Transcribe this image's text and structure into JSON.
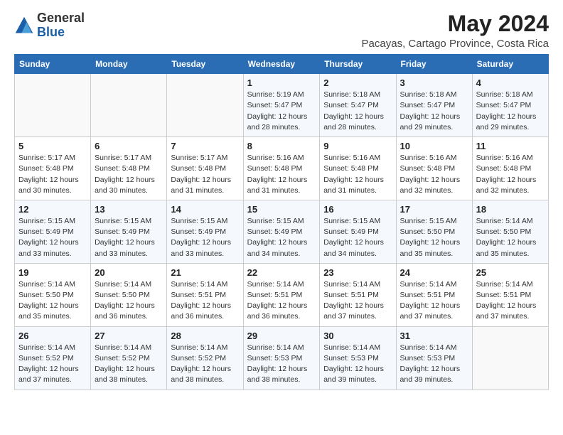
{
  "header": {
    "logo_line1": "General",
    "logo_line2": "Blue",
    "title": "May 2024",
    "subtitle": "Pacayas, Cartago Province, Costa Rica"
  },
  "weekdays": [
    "Sunday",
    "Monday",
    "Tuesday",
    "Wednesday",
    "Thursday",
    "Friday",
    "Saturday"
  ],
  "weeks": [
    [
      {
        "day": "",
        "info": ""
      },
      {
        "day": "",
        "info": ""
      },
      {
        "day": "",
        "info": ""
      },
      {
        "day": "1",
        "info": "Sunrise: 5:19 AM\nSunset: 5:47 PM\nDaylight: 12 hours\nand 28 minutes."
      },
      {
        "day": "2",
        "info": "Sunrise: 5:18 AM\nSunset: 5:47 PM\nDaylight: 12 hours\nand 28 minutes."
      },
      {
        "day": "3",
        "info": "Sunrise: 5:18 AM\nSunset: 5:47 PM\nDaylight: 12 hours\nand 29 minutes."
      },
      {
        "day": "4",
        "info": "Sunrise: 5:18 AM\nSunset: 5:47 PM\nDaylight: 12 hours\nand 29 minutes."
      }
    ],
    [
      {
        "day": "5",
        "info": "Sunrise: 5:17 AM\nSunset: 5:48 PM\nDaylight: 12 hours\nand 30 minutes."
      },
      {
        "day": "6",
        "info": "Sunrise: 5:17 AM\nSunset: 5:48 PM\nDaylight: 12 hours\nand 30 minutes."
      },
      {
        "day": "7",
        "info": "Sunrise: 5:17 AM\nSunset: 5:48 PM\nDaylight: 12 hours\nand 31 minutes."
      },
      {
        "day": "8",
        "info": "Sunrise: 5:16 AM\nSunset: 5:48 PM\nDaylight: 12 hours\nand 31 minutes."
      },
      {
        "day": "9",
        "info": "Sunrise: 5:16 AM\nSunset: 5:48 PM\nDaylight: 12 hours\nand 31 minutes."
      },
      {
        "day": "10",
        "info": "Sunrise: 5:16 AM\nSunset: 5:48 PM\nDaylight: 12 hours\nand 32 minutes."
      },
      {
        "day": "11",
        "info": "Sunrise: 5:16 AM\nSunset: 5:48 PM\nDaylight: 12 hours\nand 32 minutes."
      }
    ],
    [
      {
        "day": "12",
        "info": "Sunrise: 5:15 AM\nSunset: 5:49 PM\nDaylight: 12 hours\nand 33 minutes."
      },
      {
        "day": "13",
        "info": "Sunrise: 5:15 AM\nSunset: 5:49 PM\nDaylight: 12 hours\nand 33 minutes."
      },
      {
        "day": "14",
        "info": "Sunrise: 5:15 AM\nSunset: 5:49 PM\nDaylight: 12 hours\nand 33 minutes."
      },
      {
        "day": "15",
        "info": "Sunrise: 5:15 AM\nSunset: 5:49 PM\nDaylight: 12 hours\nand 34 minutes."
      },
      {
        "day": "16",
        "info": "Sunrise: 5:15 AM\nSunset: 5:49 PM\nDaylight: 12 hours\nand 34 minutes."
      },
      {
        "day": "17",
        "info": "Sunrise: 5:15 AM\nSunset: 5:50 PM\nDaylight: 12 hours\nand 35 minutes."
      },
      {
        "day": "18",
        "info": "Sunrise: 5:14 AM\nSunset: 5:50 PM\nDaylight: 12 hours\nand 35 minutes."
      }
    ],
    [
      {
        "day": "19",
        "info": "Sunrise: 5:14 AM\nSunset: 5:50 PM\nDaylight: 12 hours\nand 35 minutes."
      },
      {
        "day": "20",
        "info": "Sunrise: 5:14 AM\nSunset: 5:50 PM\nDaylight: 12 hours\nand 36 minutes."
      },
      {
        "day": "21",
        "info": "Sunrise: 5:14 AM\nSunset: 5:51 PM\nDaylight: 12 hours\nand 36 minutes."
      },
      {
        "day": "22",
        "info": "Sunrise: 5:14 AM\nSunset: 5:51 PM\nDaylight: 12 hours\nand 36 minutes."
      },
      {
        "day": "23",
        "info": "Sunrise: 5:14 AM\nSunset: 5:51 PM\nDaylight: 12 hours\nand 37 minutes."
      },
      {
        "day": "24",
        "info": "Sunrise: 5:14 AM\nSunset: 5:51 PM\nDaylight: 12 hours\nand 37 minutes."
      },
      {
        "day": "25",
        "info": "Sunrise: 5:14 AM\nSunset: 5:51 PM\nDaylight: 12 hours\nand 37 minutes."
      }
    ],
    [
      {
        "day": "26",
        "info": "Sunrise: 5:14 AM\nSunset: 5:52 PM\nDaylight: 12 hours\nand 37 minutes."
      },
      {
        "day": "27",
        "info": "Sunrise: 5:14 AM\nSunset: 5:52 PM\nDaylight: 12 hours\nand 38 minutes."
      },
      {
        "day": "28",
        "info": "Sunrise: 5:14 AM\nSunset: 5:52 PM\nDaylight: 12 hours\nand 38 minutes."
      },
      {
        "day": "29",
        "info": "Sunrise: 5:14 AM\nSunset: 5:53 PM\nDaylight: 12 hours\nand 38 minutes."
      },
      {
        "day": "30",
        "info": "Sunrise: 5:14 AM\nSunset: 5:53 PM\nDaylight: 12 hours\nand 39 minutes."
      },
      {
        "day": "31",
        "info": "Sunrise: 5:14 AM\nSunset: 5:53 PM\nDaylight: 12 hours\nand 39 minutes."
      },
      {
        "day": "",
        "info": ""
      }
    ]
  ]
}
